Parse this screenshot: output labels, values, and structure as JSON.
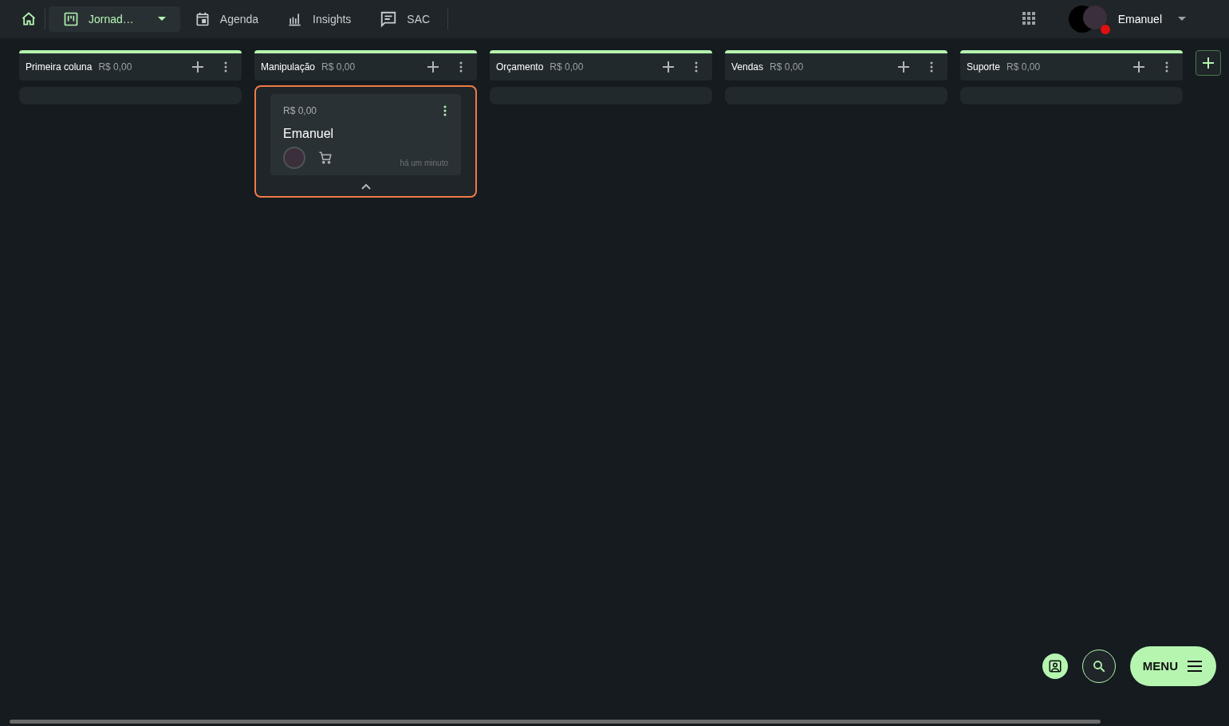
{
  "navbar": {
    "items": [
      {
        "kind": "board",
        "label": "Jornad…",
        "selected": true
      },
      {
        "kind": "calendar",
        "label": "Agenda",
        "selected": false
      },
      {
        "kind": "chart",
        "label": "Insights",
        "selected": false
      },
      {
        "kind": "chat",
        "label": "SAC",
        "selected": false
      }
    ],
    "user": {
      "name": "Emanuel",
      "online": false
    }
  },
  "columns": [
    {
      "title": "Primeira coluna",
      "total": "R$ 0,00"
    },
    {
      "title": "Manipulação",
      "total": "R$ 0,00",
      "cards": [
        {
          "value": "R$ 0,00",
          "name": "Emanuel",
          "time": "há um minuto",
          "selected": true
        }
      ]
    },
    {
      "title": "Orçamento",
      "total": "R$ 0,00"
    },
    {
      "title": "Vendas",
      "total": "R$ 0,00"
    },
    {
      "title": "Suporte",
      "total": "R$ 0,00"
    }
  ],
  "fab": {
    "menu_label": "MENU"
  }
}
